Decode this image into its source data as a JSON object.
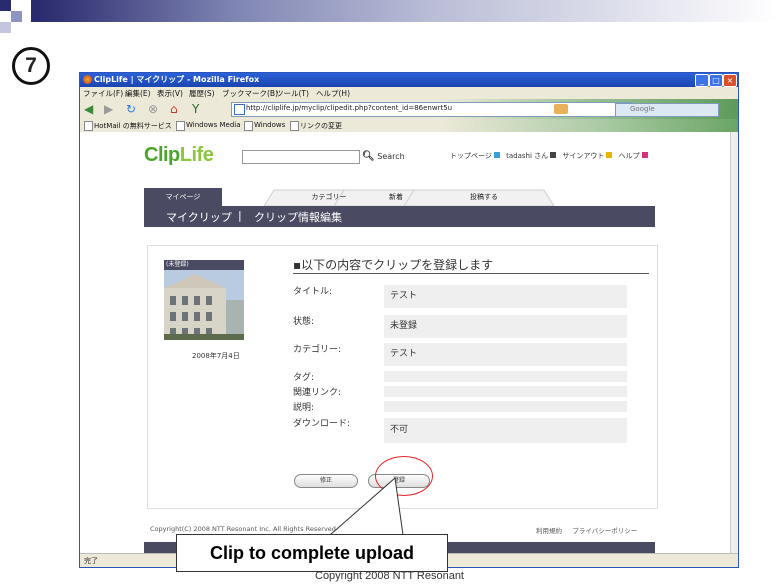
{
  "slide": {
    "step_number": "7",
    "callout_text": "Clip to complete upload",
    "copyright": "Copyright 2008 NTT Resonant"
  },
  "browser": {
    "title": "ClipLife | マイクリップ - Mozilla Firefox",
    "menu": [
      "ファイル(F)",
      "編集(E)",
      "表示(V)",
      "履歴(S)",
      "ブックマーク(B)",
      "ツール(T)",
      "ヘルプ(H)"
    ],
    "url": "http://cliplife.jp/myclip/clipedit.php?content_id=86enwrt5u",
    "search_placeholder": "Google",
    "bookmarks": [
      "HotMail の無料サービス",
      "Windows Media",
      "Windows",
      "リンクの変更"
    ],
    "status": "完了"
  },
  "site": {
    "logo_clip": "Clip",
    "logo_life": "Life",
    "search_label": "Search",
    "top_links": {
      "toppage": "トップページ",
      "user": "tadashi さん",
      "signout": "サインアウト",
      "help": "ヘルプ"
    },
    "tabs": [
      "マイページ",
      "カテゴリー",
      "新着",
      "投稿する"
    ],
    "subnav": [
      "マイクリップ",
      "|",
      "クリップ情報編集"
    ]
  },
  "clip": {
    "status_tag": "(未登録)",
    "date": "2008年7月4日",
    "heading": "▪以下の内容でクリップを登録します",
    "fields": [
      {
        "label": "タイトル:",
        "value": "テスト"
      },
      {
        "label": "状態:",
        "value": "未登録"
      },
      {
        "label": "カテゴリー:",
        "value": "テスト"
      },
      {
        "label": "タグ:",
        "value": ""
      },
      {
        "label": "関連リンク:",
        "value": ""
      },
      {
        "label": "説明:",
        "value": ""
      },
      {
        "label": "ダウンロード:",
        "value": "不可"
      }
    ],
    "buttons": {
      "edit": "修正",
      "register": "登録"
    }
  },
  "footer": {
    "copyright": "Copyright(C) 2008 NTT Resonant Inc. All Rights Reserved.",
    "links": [
      "利用規約",
      "プライバシーポリシー"
    ]
  },
  "colors": {
    "nav_dark": "#4a4a63",
    "logo_green": "#4aa52a",
    "highlight_red": "#e2262a",
    "titlebar_blue": "#2b61d8"
  }
}
